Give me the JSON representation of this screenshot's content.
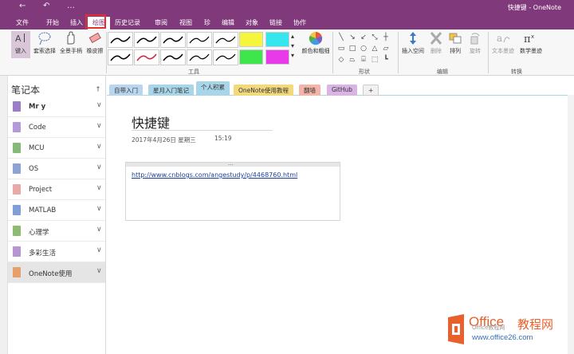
{
  "app": {
    "title": "快捷键 - OneNote"
  },
  "tabs": [
    {
      "label": "文件"
    },
    {
      "label": "开始"
    },
    {
      "label": "插入"
    },
    {
      "label": "绘图"
    },
    {
      "label": "历史记录"
    },
    {
      "label": "审阅"
    },
    {
      "label": "视图"
    },
    {
      "label": "珍"
    },
    {
      "label": "编辑"
    },
    {
      "label": "对象"
    },
    {
      "label": "链接"
    },
    {
      "label": "协作"
    }
  ],
  "ribbon": {
    "type_btn": "键入",
    "lasso_btn": "套索选择",
    "pan_btn": "全景手柄",
    "eraser_btn": "橡皮擦",
    "color_btn": "颜色和粗细",
    "insert_space_btn": "插入空间",
    "delete_btn": "删除",
    "arrange_btn": "排列",
    "rotate_btn": "旋转",
    "ink_to_text_btn": "文本墨迹",
    "ink_to_math_btn": "数学墨迹",
    "group_tools": "工具",
    "group_shapes": "形状",
    "group_edit": "编辑",
    "group_convert": "转换",
    "colors": {
      "yellow": "#f5f53b",
      "green": "#3ee64c",
      "cyan": "#35e6ef",
      "magenta": "#e83ae8"
    }
  },
  "notebooks": {
    "header": "笔记本",
    "items": [
      {
        "label": "Mr y",
        "color": "#9a7fc6"
      },
      {
        "label": "Code",
        "color": "#b49ad8"
      },
      {
        "label": "MCU",
        "color": "#86b97a"
      },
      {
        "label": "OS",
        "color": "#8ca3d4"
      },
      {
        "label": "Project",
        "color": "#e8a9a9"
      },
      {
        "label": "MATLAB",
        "color": "#7f9fd6"
      },
      {
        "label": "心理学",
        "color": "#8dbb72"
      },
      {
        "label": "多彩生活",
        "color": "#b795d3"
      },
      {
        "label": "OneNote使用",
        "color": "#e8a06a"
      }
    ]
  },
  "sections": [
    {
      "label": "自带入门",
      "color": "#b9d6ee"
    },
    {
      "label": "星月入门笔记",
      "color": "#a9d5e8"
    },
    {
      "label": "个人积累",
      "color": "#a9d5e8"
    },
    {
      "label": "OneNote使用教程",
      "color": "#f1d97c"
    },
    {
      "label": "翻墙",
      "color": "#f2b5a7"
    },
    {
      "label": "GitHub",
      "color": "#d9b4e4"
    },
    {
      "label": "+",
      "color": "#f1f1f1"
    }
  ],
  "page": {
    "title": "快捷键",
    "date": "2017年4月26日 星期三",
    "time": "15:19",
    "link": "http://www.cnblogs.com/angestudy/p/4468760.html"
  },
  "watermark": {
    "brand_a": "Office",
    "brand_b": "教程网",
    "url": "www.office26.com",
    "wechat": "Office教程网"
  }
}
